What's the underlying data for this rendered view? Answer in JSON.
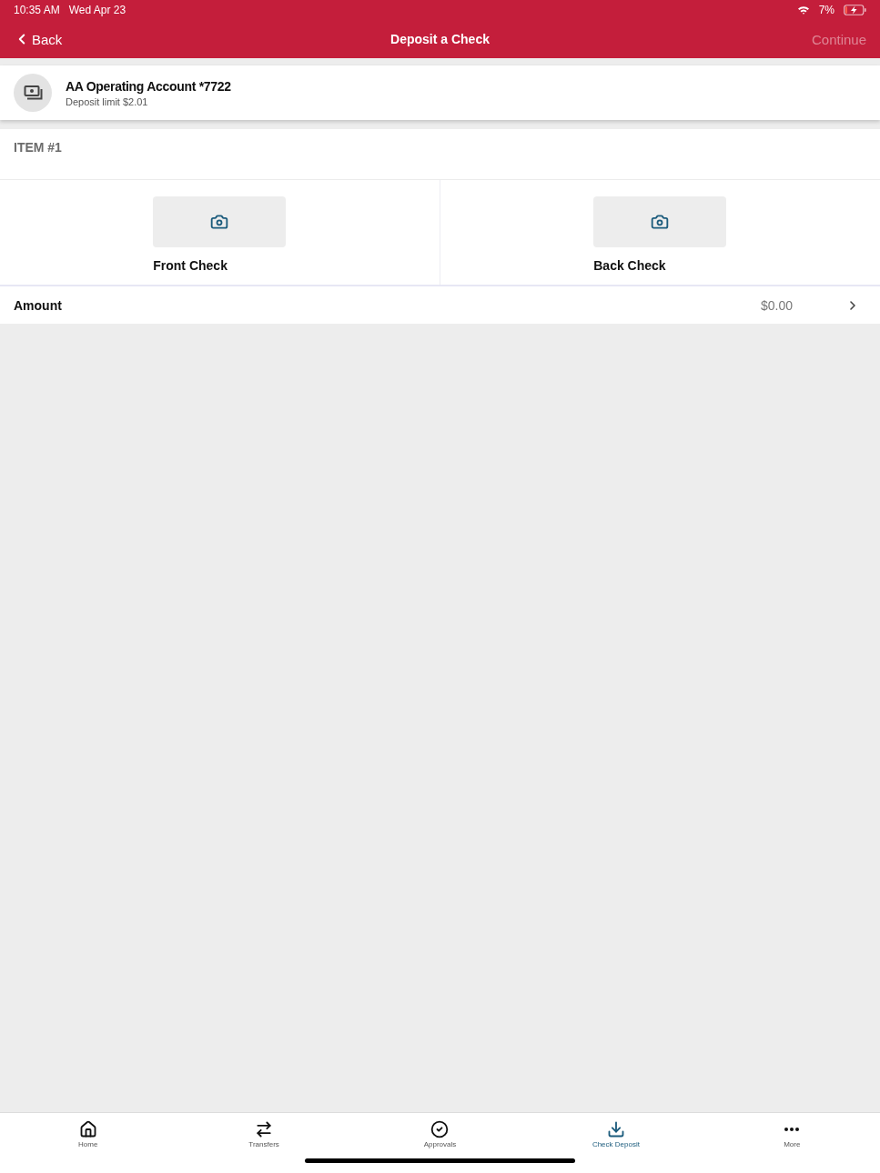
{
  "status_bar": {
    "time": "10:35 AM",
    "date": "Wed Apr 23",
    "battery": "7%"
  },
  "nav": {
    "back": "Back",
    "title": "Deposit a Check",
    "continue": {
      "label": "Continue",
      "disabled": true
    }
  },
  "account": {
    "name": "AA Operating Account *7722",
    "limit": "Deposit limit $2.01"
  },
  "item": {
    "heading": "ITEM #1",
    "captures": [
      {
        "label": "Front Check"
      },
      {
        "label": "Back Check"
      }
    ],
    "amount": {
      "label": "Amount",
      "value": "$0.00"
    }
  },
  "tab_bar": {
    "tabs": [
      {
        "label": "Home",
        "kind": "home",
        "selected": false
      },
      {
        "label": "Transfers",
        "kind": "transfers",
        "selected": false
      },
      {
        "label": "Approvals",
        "kind": "approvals",
        "selected": false
      },
      {
        "label": "Check Deposit",
        "kind": "deposit",
        "selected": true
      },
      {
        "label": "More",
        "kind": "more",
        "selected": false
      }
    ]
  }
}
